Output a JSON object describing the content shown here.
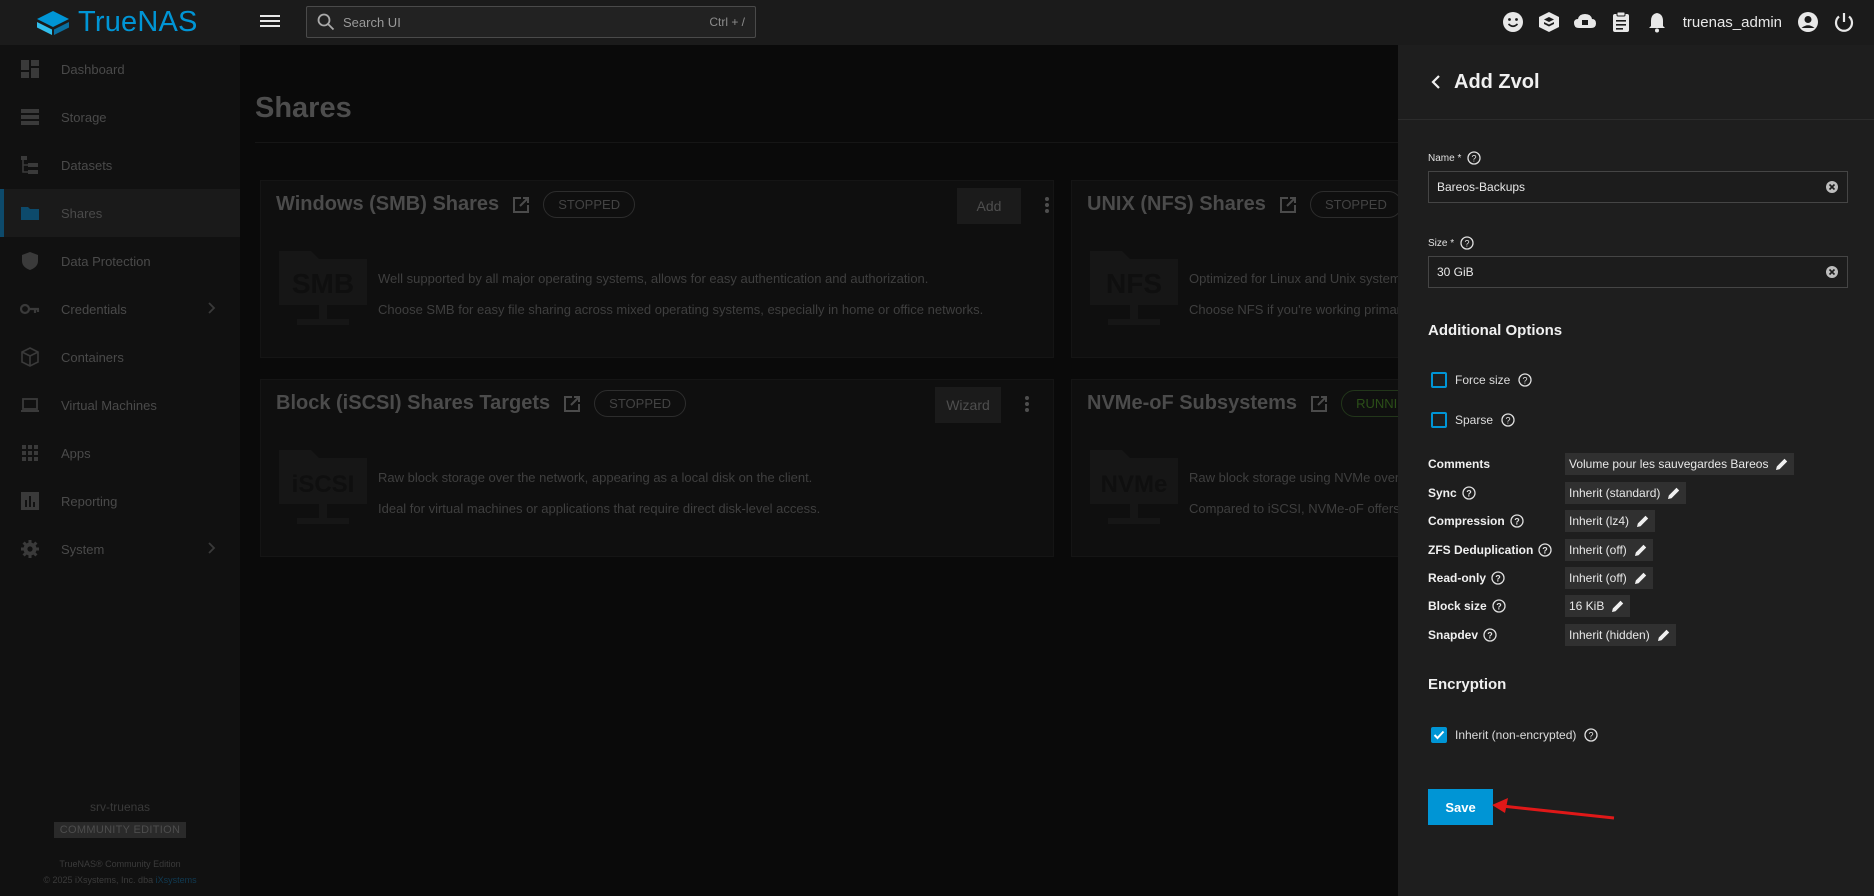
{
  "app": {
    "brand": "TrueNAS",
    "search_placeholder": "Search UI",
    "search_shortcut": "Ctrl + /",
    "username": "truenas_admin"
  },
  "colors": {
    "accent": "#0095d5",
    "drawer_bg": "#1e1e1e",
    "annotation_arrow": "#e01818"
  },
  "sidebar": {
    "items": [
      {
        "label": "Dashboard",
        "icon": "dashboard-icon"
      },
      {
        "label": "Storage",
        "icon": "storage-icon"
      },
      {
        "label": "Datasets",
        "icon": "datasets-icon"
      },
      {
        "label": "Shares",
        "icon": "shares-icon",
        "active": true
      },
      {
        "label": "Data Protection",
        "icon": "shield-icon"
      },
      {
        "label": "Credentials",
        "icon": "key-icon",
        "has_children": true
      },
      {
        "label": "Containers",
        "icon": "cube-icon"
      },
      {
        "label": "Virtual Machines",
        "icon": "laptop-icon"
      },
      {
        "label": "Apps",
        "icon": "apps-grid-icon"
      },
      {
        "label": "Reporting",
        "icon": "chart-icon"
      },
      {
        "label": "System",
        "icon": "gear-icon",
        "has_children": true
      }
    ],
    "hostname": "srv-truenas",
    "edition": "COMMUNITY EDITION",
    "copyright_line1": "TrueNAS® Community Edition",
    "copyright_line2": "© 2025 iXsystems, Inc. dba",
    "copyright_link": "iXsystems"
  },
  "main": {
    "title": "Shares",
    "cards": [
      {
        "title": "Windows (SMB) Shares",
        "status": "STOPPED",
        "button": "Add",
        "art": "SMB",
        "desc1": "Well supported by all major operating systems, allows for easy authentication and authorization.",
        "desc2": "Choose SMB for easy file sharing across mixed operating systems, especially in home or office networks."
      },
      {
        "title": "UNIX (NFS) Shares",
        "status": "STOPPED",
        "art": "NFS",
        "desc1": "Optimized for Linux and Unix systems",
        "desc2": "Choose NFS if you're working primari"
      },
      {
        "title": "Block (iSCSI) Shares Targets",
        "status": "STOPPED",
        "button": "Wizard",
        "art": "iSCSI",
        "desc1": "Raw block storage over the network, appearing as a local disk on the client.",
        "desc2": "Ideal for virtual machines or applications that require direct disk-level access."
      },
      {
        "title": "NVMe-oF Subsystems",
        "status": "RUNNIN",
        "art": "NVMe",
        "desc1": "Raw block storage using NVMe over F",
        "desc2": "Compared to iSCSI, NVMe-oF offers s"
      }
    ]
  },
  "drawer": {
    "title": "Add Zvol",
    "name_label": "Name *",
    "name_value": "Bareos-Backups",
    "size_label": "Size *",
    "size_value": "30 GiB",
    "additional_options": "Additional Options",
    "force_size": "Force size",
    "sparse": "Sparse",
    "options": [
      {
        "label": "Comments",
        "value": "Volume pour les sauvegardes Bareos",
        "help": false
      },
      {
        "label": "Sync",
        "value": "Inherit (standard)",
        "help": true
      },
      {
        "label": "Compression",
        "value": "Inherit (lz4)",
        "help": true
      },
      {
        "label": "ZFS Deduplication",
        "value": "Inherit (off)",
        "help": true
      },
      {
        "label": "Read-only",
        "value": "Inherit (off)",
        "help": true
      },
      {
        "label": "Block size",
        "value": "16 KiB",
        "help": true
      },
      {
        "label": "Snapdev",
        "value": "Inherit (hidden)",
        "help": true
      }
    ],
    "encryption": "Encryption",
    "inherit_encryption": "Inherit (non-encrypted)",
    "save": "Save"
  }
}
